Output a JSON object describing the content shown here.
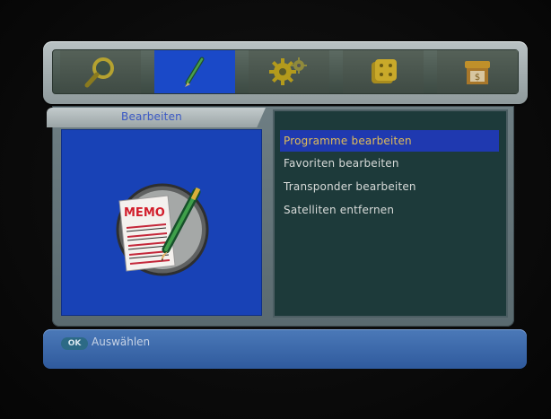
{
  "menu": {
    "tabs": [
      {
        "icon": "magnifier-icon",
        "active": false
      },
      {
        "icon": "pencil-icon",
        "active": true
      },
      {
        "icon": "gears-icon",
        "active": false
      },
      {
        "icon": "dice-icon",
        "active": false
      },
      {
        "icon": "shop-icon",
        "active": false
      }
    ],
    "section_title": "Bearbeiten",
    "illustration_icon": "memo-pencil-icon",
    "illustration_text": "MEMO",
    "items": [
      {
        "label": "Programme bearbeiten",
        "selected": true
      },
      {
        "label": "Favoriten bearbeiten",
        "selected": false
      },
      {
        "label": "Transponder bearbeiten",
        "selected": false
      },
      {
        "label": "Satelliten entfernen",
        "selected": false
      }
    ]
  },
  "footer": {
    "ok_badge": "OK",
    "action_label": "Auswählen"
  },
  "colors": {
    "accent_blue": "#1a49c8",
    "selected_text": "#e1bd58",
    "list_background": "#1d3a3a"
  }
}
